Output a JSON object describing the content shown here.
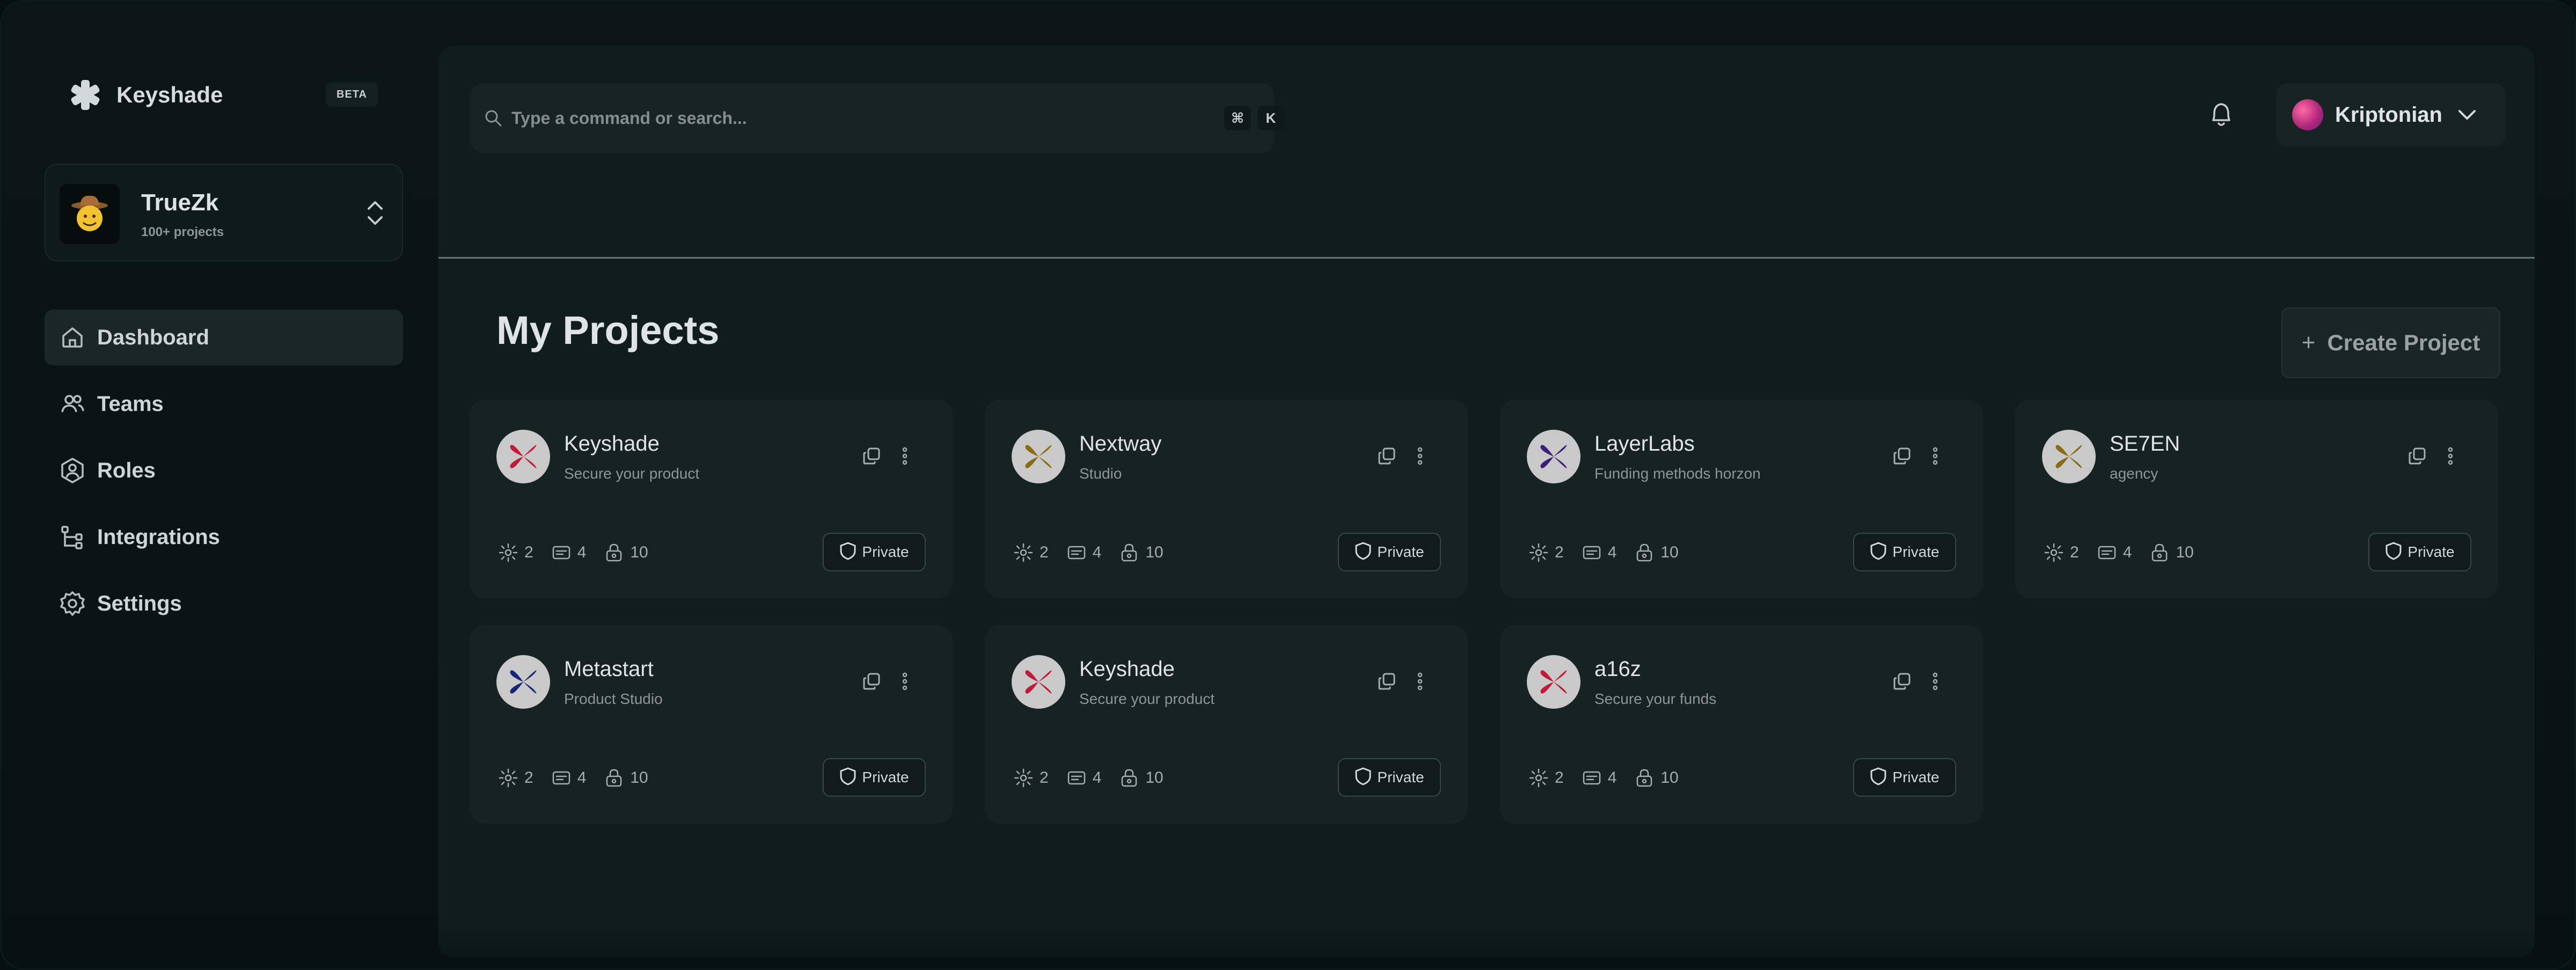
{
  "brand": {
    "name": "Keyshade",
    "badge": "BETA"
  },
  "workspace": {
    "name": "TrueZk",
    "subtitle": "100+ projects",
    "avatar": "cowboy-emoji"
  },
  "nav": {
    "items": [
      {
        "label": "Dashboard",
        "icon": "home-icon",
        "active": true
      },
      {
        "label": "Teams",
        "icon": "users-icon",
        "active": false
      },
      {
        "label": "Roles",
        "icon": "user-hexagon-icon",
        "active": false
      },
      {
        "label": "Integrations",
        "icon": "integrations-icon",
        "active": false
      },
      {
        "label": "Settings",
        "icon": "gear-icon",
        "active": false
      }
    ]
  },
  "search": {
    "placeholder": "Type a command or search...",
    "shortcut_mod": "⌘",
    "shortcut_key": "K"
  },
  "user": {
    "name": "Kriptonian"
  },
  "page": {
    "title": "My Projects",
    "create_label": "Create Project",
    "create_icon": "+"
  },
  "projects": [
    {
      "name": "Keyshade",
      "description": "Secure your product",
      "logo_color": "#c3183a",
      "environments": "2",
      "variables": "4",
      "secrets": "10",
      "visibility": "Private"
    },
    {
      "name": "Nextway",
      "description": "Studio",
      "logo_color": "#8a6a12",
      "environments": "2",
      "variables": "4",
      "secrets": "10",
      "visibility": "Private"
    },
    {
      "name": "LayerLabs",
      "description": "Funding methods horzon",
      "logo_color": "#3b1e7a",
      "environments": "2",
      "variables": "4",
      "secrets": "10",
      "visibility": "Private"
    },
    {
      "name": "SE7EN",
      "description": "agency",
      "logo_color": "#8a6a12",
      "environments": "2",
      "variables": "4",
      "secrets": "10",
      "visibility": "Private"
    },
    {
      "name": "Metastart",
      "description": "Product Studio",
      "logo_color": "#16247a",
      "environments": "2",
      "variables": "4",
      "secrets": "10",
      "visibility": "Private"
    },
    {
      "name": "Keyshade",
      "description": "Secure your product",
      "logo_color": "#c3183a",
      "environments": "2",
      "variables": "4",
      "secrets": "10",
      "visibility": "Private"
    },
    {
      "name": "a16z",
      "description": "Secure your funds",
      "logo_color": "#c3183a",
      "environments": "2",
      "variables": "4",
      "secrets": "10",
      "visibility": "Private"
    }
  ]
}
